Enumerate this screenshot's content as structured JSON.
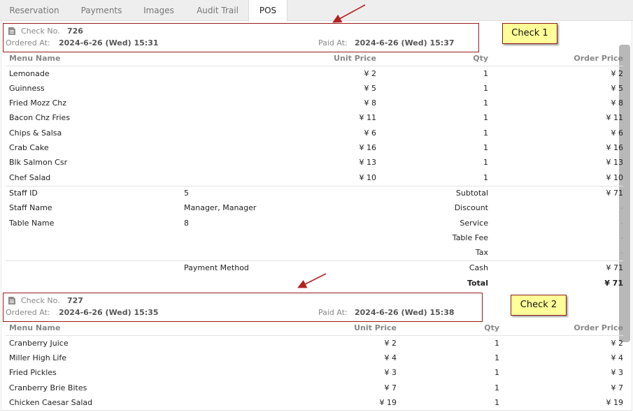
{
  "tabs": [
    {
      "label": "Reservation",
      "active": false
    },
    {
      "label": "Payments",
      "active": false
    },
    {
      "label": "Images",
      "active": false
    },
    {
      "label": "Audit Trail",
      "active": false
    },
    {
      "label": "POS",
      "active": true
    }
  ],
  "labels": {
    "check_no": "Check No.",
    "ordered_at": "Ordered At:",
    "paid_at": "Paid At:",
    "menu_name": "Menu Name",
    "unit_price": "Unit Price",
    "qty": "Qty",
    "order_price": "Order Price",
    "staff_id": "Staff ID",
    "staff_name": "Staff Name",
    "table_name": "Table Name",
    "payment_method": "Payment Method",
    "subtotal": "Subtotal",
    "discount": "Discount",
    "service": "Service",
    "table_fee": "Table Fee",
    "tax": "Tax",
    "total": "Total"
  },
  "check1": {
    "number": "726",
    "ordered_at": "2024-6-26 (Wed) 15:31",
    "paid_at": "2024-6-26 (Wed) 15:37",
    "items": [
      {
        "name": "Lemonade",
        "unit_price": "¥ 2",
        "qty": "1",
        "order_price": "¥ 2"
      },
      {
        "name": "Guinness",
        "unit_price": "¥ 5",
        "qty": "1",
        "order_price": "¥ 5"
      },
      {
        "name": "Fried Mozz Chz",
        "unit_price": "¥ 8",
        "qty": "1",
        "order_price": "¥ 8"
      },
      {
        "name": "Bacon Chz Fries",
        "unit_price": "¥ 11",
        "qty": "1",
        "order_price": "¥ 11"
      },
      {
        "name": "Chips & Salsa",
        "unit_price": "¥ 6",
        "qty": "1",
        "order_price": "¥ 6"
      },
      {
        "name": "Crab Cake",
        "unit_price": "¥ 16",
        "qty": "1",
        "order_price": "¥ 16"
      },
      {
        "name": "Blk Salmon Csr",
        "unit_price": "¥ 13",
        "qty": "1",
        "order_price": "¥ 13"
      },
      {
        "name": "Chef Salad",
        "unit_price": "¥ 10",
        "qty": "1",
        "order_price": "¥ 10"
      }
    ],
    "staff_id": "5",
    "staff_name": "Manager, Manager",
    "table_name": "8",
    "payment_method_value": "Cash",
    "subtotal": "¥ 71",
    "discount": "-",
    "service": "-",
    "table_fee": "-",
    "tax": "-",
    "payment_amount": "¥ 71",
    "total": "¥ 71"
  },
  "check2": {
    "number": "727",
    "ordered_at": "2024-6-26 (Wed) 15:35",
    "paid_at": "2024-6-26 (Wed) 15:38",
    "items": [
      {
        "name": "Cranberry Juice",
        "unit_price": "¥ 2",
        "qty": "1",
        "order_price": "¥ 2"
      },
      {
        "name": "Miller High Life",
        "unit_price": "¥ 4",
        "qty": "1",
        "order_price": "¥ 4"
      },
      {
        "name": "Fried Pickles",
        "unit_price": "¥ 3",
        "qty": "1",
        "order_price": "¥ 3"
      },
      {
        "name": "Cranberry Brie Bites",
        "unit_price": "¥ 7",
        "qty": "1",
        "order_price": "¥ 7"
      },
      {
        "name": "Chicken Caesar Salad",
        "unit_price": "¥ 19",
        "qty": "1",
        "order_price": "¥ 19"
      }
    ]
  },
  "callouts": {
    "check1": "Check 1",
    "check2": "Check 2"
  },
  "colors": {
    "highlight_border": "#9b1b1b",
    "callout_bg": "#ffff99",
    "arrow": "#b22222"
  }
}
